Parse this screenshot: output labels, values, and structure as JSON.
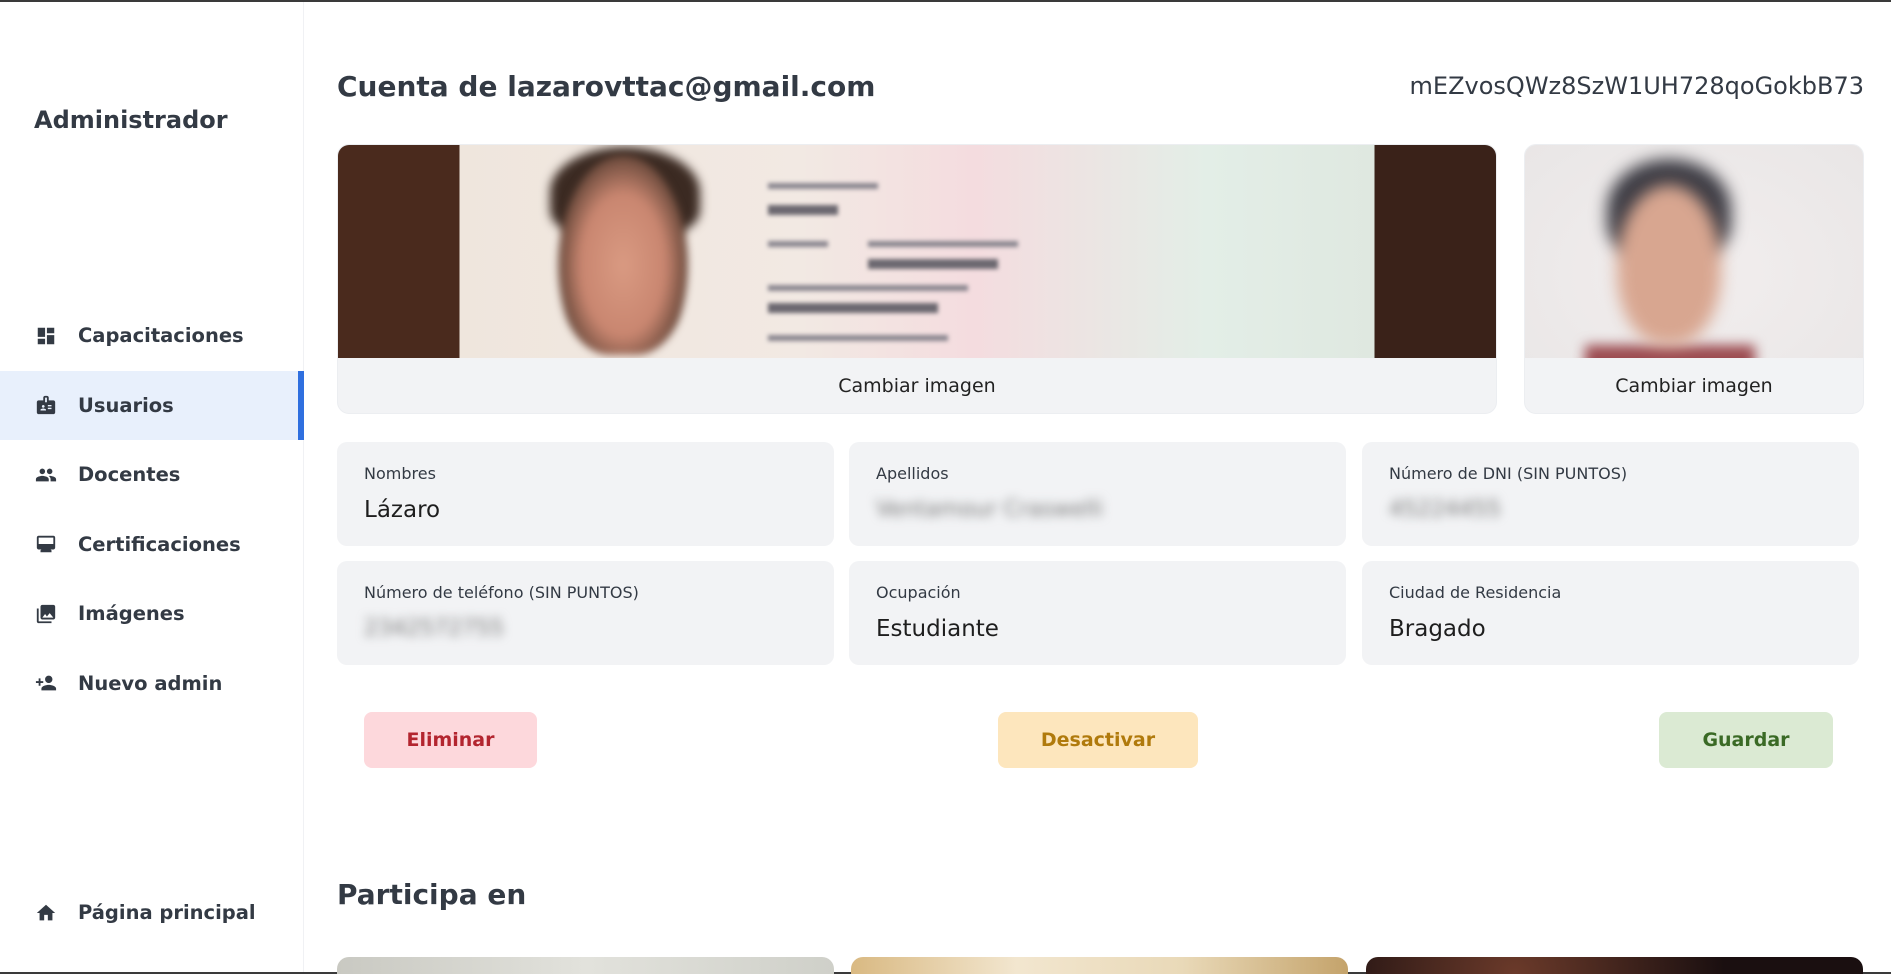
{
  "sidebar": {
    "title": "Administrador",
    "items": [
      {
        "label": "Capacitaciones",
        "icon": "dashboard-icon"
      },
      {
        "label": "Usuarios",
        "icon": "badge-icon"
      },
      {
        "label": "Docentes",
        "icon": "people-icon"
      },
      {
        "label": "Certificaciones",
        "icon": "monitor-icon"
      },
      {
        "label": "Imágenes",
        "icon": "images-icon"
      },
      {
        "label": "Nuevo admin",
        "icon": "person-add-icon"
      }
    ],
    "active_item": "Usuarios",
    "bottom_item": {
      "label": "Página principal",
      "icon": "home-icon"
    }
  },
  "header": {
    "title": "Cuenta de lazarovttac@gmail.com",
    "uid": "mEZvosQWz8SzW1UH728qoGokbB73"
  },
  "images": {
    "dni_button": "Cambiar imagen",
    "selfie_button": "Cambiar imagen"
  },
  "fields": {
    "nombres": {
      "label": "Nombres",
      "value": "Lázaro"
    },
    "apellidos": {
      "label": "Apellidos",
      "value": "Ventamour Craswelli"
    },
    "dni": {
      "label": "Número de DNI (SIN PUNTOS)",
      "value": "45224455"
    },
    "telefono": {
      "label": "Número de teléfono (SIN PUNTOS)",
      "value": "2342572755"
    },
    "ocupacion": {
      "label": "Ocupación",
      "value": "Estudiante"
    },
    "ciudad": {
      "label": "Ciudad de Residencia",
      "value": "Bragado"
    }
  },
  "actions": {
    "delete": "Eliminar",
    "deactivate": "Desactivar",
    "save": "Guardar"
  },
  "participa": {
    "title": "Participa en"
  },
  "colors": {
    "accent": "#2f6fdf",
    "active_bg": "#e8f0fc",
    "delete_bg": "#fdd8dc",
    "deactivate_bg": "#fde6bd",
    "save_bg": "#dbead3"
  }
}
